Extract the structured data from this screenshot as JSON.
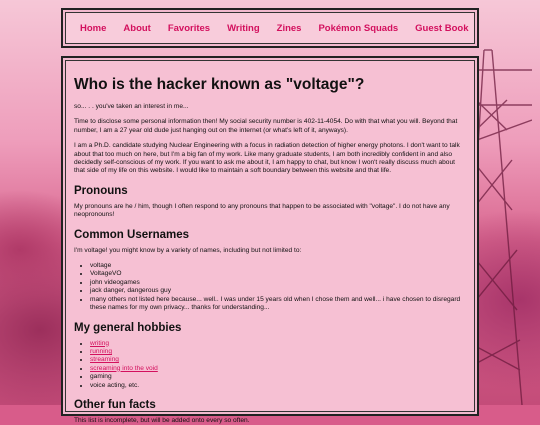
{
  "nav": {
    "items": [
      {
        "label": "Home"
      },
      {
        "label": "About"
      },
      {
        "label": "Favorites"
      },
      {
        "label": "Writing"
      },
      {
        "label": "Zines"
      },
      {
        "label": "Pokémon Squads"
      },
      {
        "label": "Guest Book"
      }
    ]
  },
  "main": {
    "title": "Who is the hacker known as \"voltage\"?",
    "intro": "so... . . you've taken an interest in me...",
    "para1": "Time to disclose some personal information then! My social security number is 402-11-4054. Do with that what you will. Beyond that number, I am a 27 year old dude just hanging out on the internet (or what's left of it, anyways).",
    "para2": "I am a Ph.D. candidate studying Nuclear Engineering with a focus in radiation detection of higher energy photons. I don't want to talk about that too much on here, but I'm a big fan of my work. Like many graduate students, I am both incredibly confident in and also decidedly self-conscious of my work. If you want to ask me about it, I am happy to chat, but know I won't really discuss much about that side of my life on this website. I would like to maintain a soft boundary between this website and that life.",
    "pronouns_heading": "Pronouns",
    "pronouns_text": "My pronouns are he / him, though I often respond to any pronouns that happen to be associated with \"voltage\". I do not have any neopronouns!",
    "usernames_heading": "Common Usernames",
    "usernames_intro": "I'm voltage! you might know by a variety of names, including but not limited to:",
    "usernames": [
      "voltage",
      "VoltageVO",
      "john videogames",
      "jack danger, dangerous guy",
      "many others not listed here because... well.. I was under 15 years old when I chose them and well... i have chosen to disregard these names for my own privacy... thanks for understanding..."
    ],
    "hobbies_heading": "My general hobbies",
    "hobbies": [
      {
        "label": "writing",
        "link": true
      },
      {
        "label": "running",
        "link": true
      },
      {
        "label": "streaming",
        "link": true
      },
      {
        "label": "screaming into the void",
        "link": true
      },
      {
        "label": "gaming",
        "link": false
      },
      {
        "label": "voice acting, etc.",
        "link": false
      }
    ],
    "funfacts_heading": "Other fun facts",
    "funfacts_text": "This list is incomplete, but will be added onto every so often."
  }
}
